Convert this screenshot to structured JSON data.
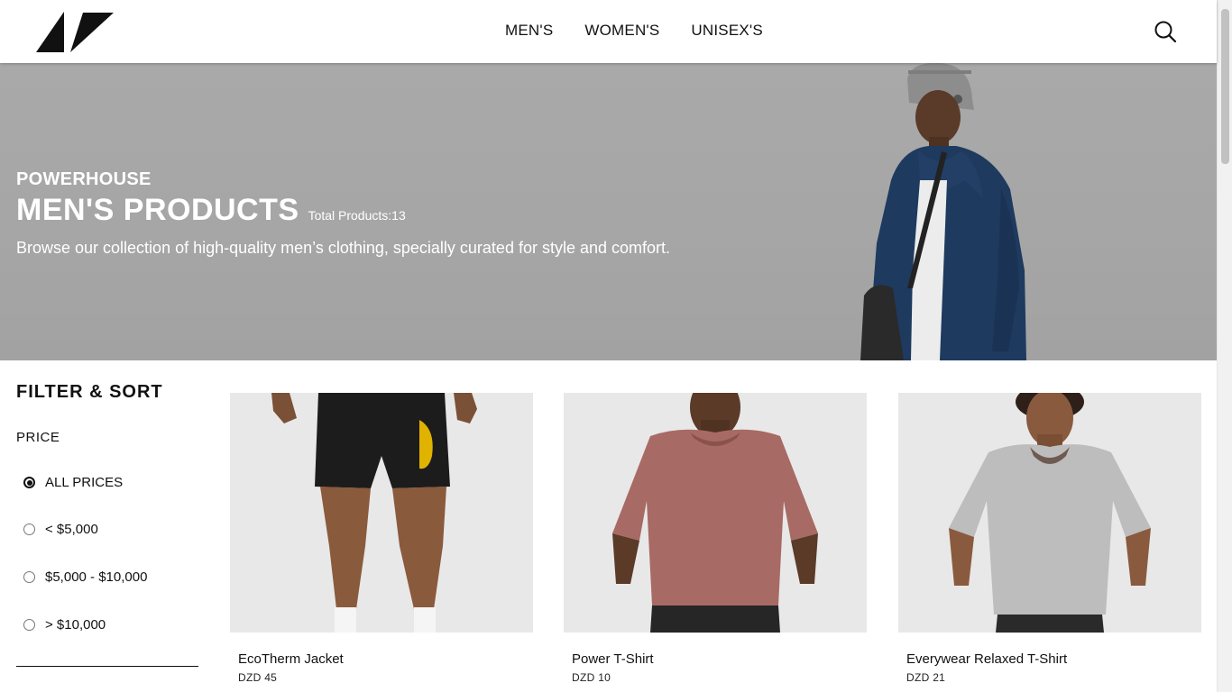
{
  "header": {
    "logo_icon": "brand-logo-icon",
    "nav": [
      {
        "label": "MEN'S"
      },
      {
        "label": "WOMEN'S"
      },
      {
        "label": "UNISEX'S"
      }
    ],
    "search_icon": "search-icon"
  },
  "hero": {
    "subtitle": "POWERHOUSE",
    "title": "MEN'S PRODUCTS",
    "count": "Total Products:13",
    "description": "Browse our collection of high-quality men’s clothing, specially curated for style and comfort."
  },
  "filter": {
    "heading": "FILTER & SORT",
    "price_label": "PRICE",
    "options": [
      {
        "label": "ALL PRICES",
        "selected": true
      },
      {
        "label": "< $5,000",
        "selected": false
      },
      {
        "label": "$5,000 - $10,000",
        "selected": false
      },
      {
        "label": "> $10,000",
        "selected": false
      }
    ]
  },
  "products": [
    {
      "name": "EcoTherm Jacket",
      "price": "DZD 45",
      "image": "black-shorts-photo"
    },
    {
      "name": "Power T-Shirt",
      "price": "DZD 10",
      "image": "pink-tshirt-photo"
    },
    {
      "name": "Everywear Relaxed T-Shirt",
      "price": "DZD 21",
      "image": "grey-tshirt-photo"
    }
  ],
  "colors": {
    "hero_bg": "#a8a8a8",
    "text": "#111111",
    "product_bg": "#e8e8e8"
  }
}
